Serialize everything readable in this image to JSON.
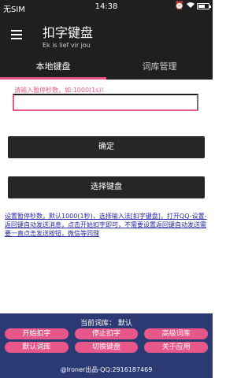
{
  "statusbar": {
    "carrier": "无SIM",
    "time": "14:38",
    "battery_level": 0.7
  },
  "appbar": {
    "title": "扣字键盘",
    "subtitle": "Ek is lief vir jou"
  },
  "tabs": [
    {
      "label": "本地键盘",
      "active": true
    },
    {
      "label": "词库管理",
      "active": false
    }
  ],
  "input": {
    "placeholder": "请输入暂停秒数，如:1000(1s)!",
    "value": ""
  },
  "buttons": {
    "confirm": "确定",
    "select_keyboard": "选择键盘"
  },
  "note": "设置暂停秒数，默认1000(1秒)，选择输入法[扣字键盘]，打开QQ-设置-返回键自动发送消息，点击开始扣字即可，不需要设置返回键自动发送需要一直点击发送按钮，微信等同理",
  "bottom": {
    "current_label": "当前词库：  默认",
    "grid": [
      "开始扣字",
      "停止扣字",
      "高级词库",
      "默认词库",
      "切换键盘",
      "关于应用"
    ],
    "credit": "@Ironer出品-QQ:2916187469"
  },
  "colors": {
    "accent": "#e8578a",
    "bar": "#1f1f1f",
    "panel": "#2b3a72",
    "link": "#2727a8"
  }
}
